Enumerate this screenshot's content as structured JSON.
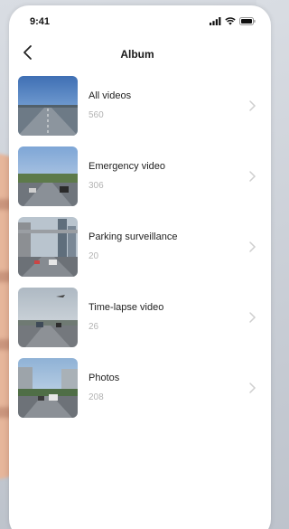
{
  "status_bar": {
    "time": "9:41"
  },
  "nav": {
    "title": "Album"
  },
  "albums": [
    {
      "title": "All videos",
      "count": "560"
    },
    {
      "title": "Emergency video",
      "count": "306"
    },
    {
      "title": "Parking surveillance",
      "count": "20"
    },
    {
      "title": "Time-lapse video",
      "count": "26"
    },
    {
      "title": "Photos",
      "count": "208"
    }
  ],
  "icons": {
    "back": "chevron-left-icon",
    "row_arrow": "chevron-right-icon",
    "signal": "signal-icon",
    "wifi": "wifi-icon",
    "battery": "battery-icon"
  },
  "colors": {
    "background": "#ffffff",
    "title_text": "#1a1a1a",
    "count_text": "#b3b3b3",
    "chevron": "#cfcfcf"
  }
}
